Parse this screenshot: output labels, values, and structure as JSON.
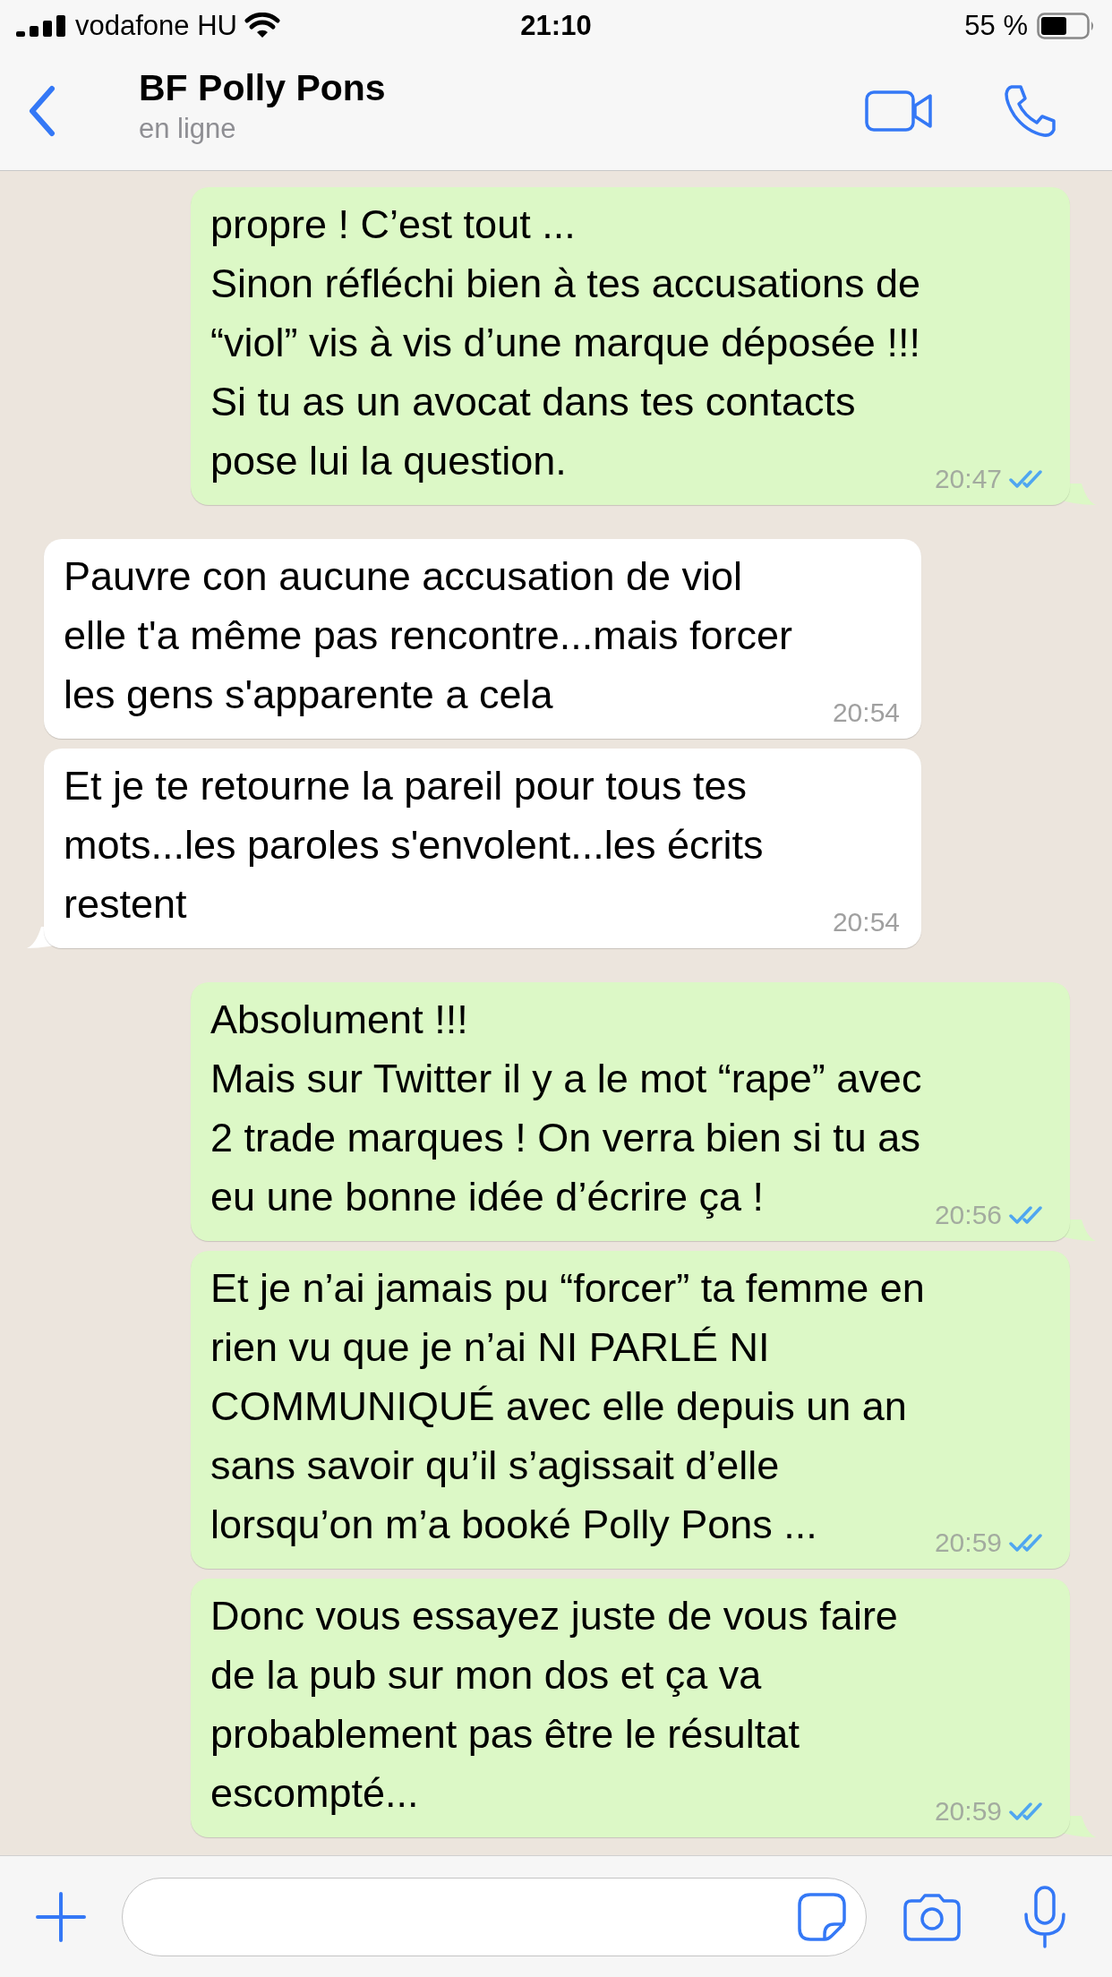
{
  "status_bar": {
    "carrier": "vodafone HU",
    "time": "21:10",
    "battery": "55 %"
  },
  "header": {
    "name": "BF Polly Pons",
    "status": "en ligne"
  },
  "messages": [
    {
      "kind": "sent",
      "text": "propre ! C’est tout ...\nSinon réfléchi bien à tes accusations de\n“viol” vis à vis d’une marque déposée !!!\nSi tu as un avocat dans tes contacts\npose lui la question.",
      "time": "20:47",
      "read": true,
      "tail": true
    },
    {
      "kind": "received",
      "text": "Pauvre con aucune accusation de viol\nelle t'a même pas rencontre...mais forcer\nles gens s'apparente a cela",
      "time": "20:54",
      "tail": false
    },
    {
      "kind": "received",
      "text": "Et je te retourne la pareil pour tous tes\nmots...les paroles s'envolent...les écrits\nrestent",
      "time": "20:54",
      "tail": true
    },
    {
      "kind": "sent",
      "text": "Absolument !!!\nMais sur Twitter il y a le mot “rape” avec\n2 trade marques ! On verra bien si tu as\neu une bonne idée d’écrire ça !",
      "time": "20:56",
      "read": true,
      "tail": true
    },
    {
      "kind": "sent",
      "text": "Et je n’ai jamais pu “forcer” ta femme en\nrien vu que je n’ai NI PARLÉ NI\nCOMMUNIQUÉ avec elle depuis un an\nsans savoir qu’il s’agissait d’elle\nlorsqu’on m’a booké Polly Pons ...",
      "time": "20:59",
      "read": true,
      "tail": false
    },
    {
      "kind": "sent",
      "text": "Donc vous essayez juste de vous faire\nde la pub sur mon dos et ça va\nprobablement pas être le résultat\nescompté...",
      "time": "20:59",
      "read": true,
      "tail": true
    }
  ]
}
